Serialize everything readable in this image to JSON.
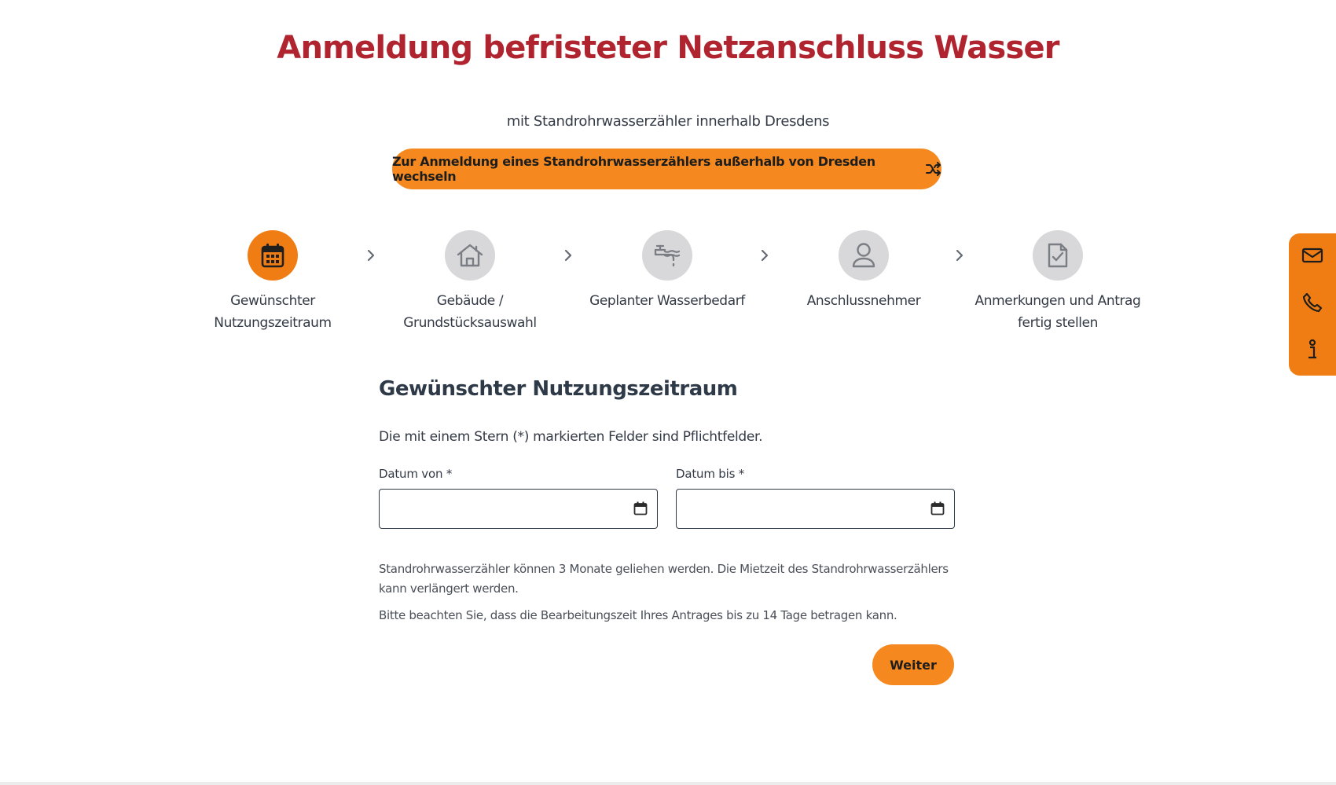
{
  "header": {
    "title": "Anmeldung befristeter Netzanschluss Wasser",
    "subtitle": "mit Standrohrwasserzähler innerhalb Dresdens",
    "switch_label": "Zur Anmeldung eines Standrohrwasserzählers außerhalb von Dresden wechseln",
    "switch_icon": "shuffle-icon"
  },
  "colors": {
    "title": "#b0242f",
    "accent": "#f5891f",
    "active_step": "#f07d13",
    "inactive_step": "#d8d8da",
    "text": "#333a45"
  },
  "stepper": {
    "active_index": 0,
    "steps": [
      {
        "label_line1": "Gewünschter",
        "label_line2": "Nutzungszeitraum",
        "icon": "calendar-icon"
      },
      {
        "label_line1": "Gebäude /",
        "label_line2": "Grundstücksauswahl",
        "icon": "house-icon"
      },
      {
        "label_line1": "Geplanter Wasserbedarf",
        "label_line2": "",
        "icon": "faucet-icon"
      },
      {
        "label_line1": "Anschlussnehmer",
        "label_line2": "",
        "icon": "person-icon"
      },
      {
        "label_line1": "Anmerkungen und Antrag",
        "label_line2": "fertig stellen",
        "icon": "document-check-icon"
      }
    ]
  },
  "side_panel": {
    "icons": [
      "mail-icon",
      "phone-icon",
      "info-icon"
    ]
  },
  "form": {
    "section_title": "Gewünschter Nutzungszeitraum",
    "required_note": "Die mit einem Stern (*) markierten Felder sind Pflichtfelder.",
    "date_from": {
      "label": "Datum von *",
      "value": ""
    },
    "date_to": {
      "label": "Datum bis *",
      "value": ""
    },
    "info_1": "Standrohrwasserzähler können 3 Monate geliehen werden. Die Mietzeit des Standrohrwasserzählers kann verlängert werden.",
    "info_2": "Bitte beachten Sie, dass die Bearbeitungszeit Ihres Antrages bis zu 14 Tage betragen kann.",
    "next_label": "Weiter"
  }
}
